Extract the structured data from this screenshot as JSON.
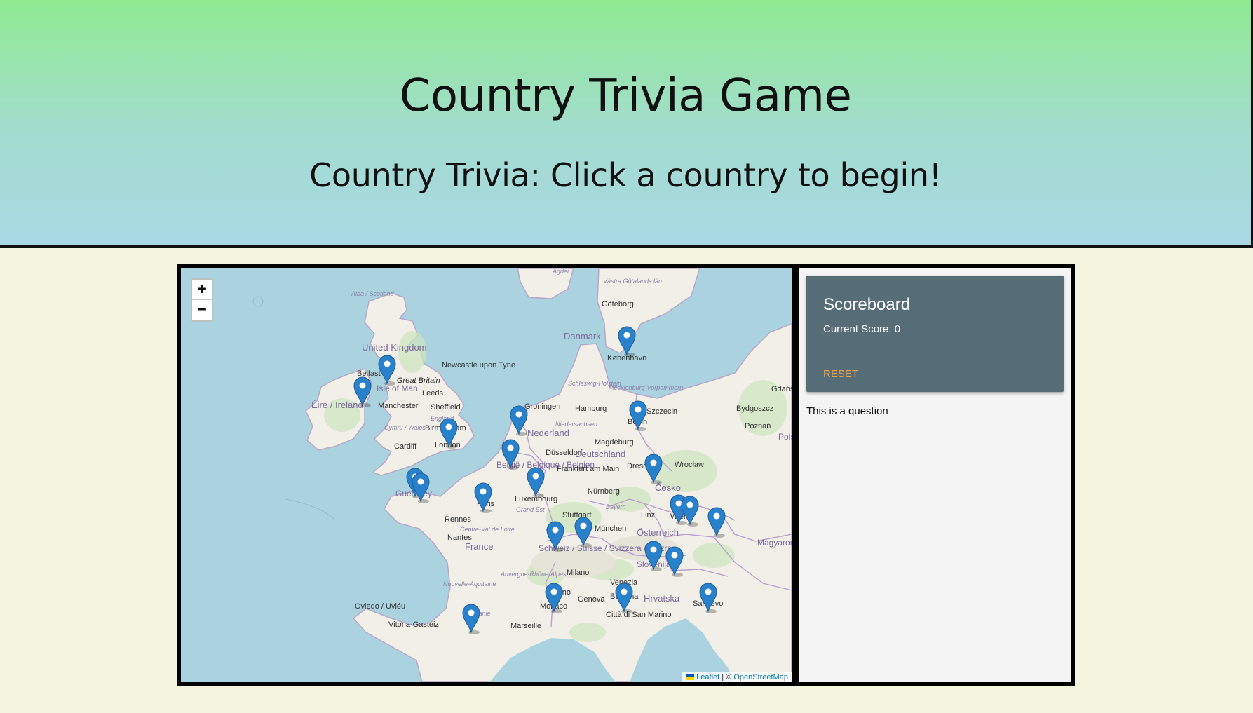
{
  "header": {
    "title": "Country Trivia Game",
    "subtitle": "Country Trivia: Click a country to begin!"
  },
  "map": {
    "zoom_in": "+",
    "zoom_out": "−",
    "attribution_leaflet": "Leaflet",
    "attribution_sep": " | © ",
    "attribution_osm": "OpenStreetMap",
    "colors": {
      "water": "#aad3df",
      "land": "#f2efe9",
      "marker": "#2a81cb"
    },
    "labels": [
      {
        "name": "Agder",
        "style": "region"
      },
      {
        "name": "Västra Götalands län",
        "style": "region"
      },
      {
        "name": "Göteborg",
        "style": "city"
      },
      {
        "name": "Alba / Scotland",
        "style": "region"
      },
      {
        "name": "United Kingdom",
        "style": "country"
      },
      {
        "name": "Danmark",
        "style": "country"
      },
      {
        "name": "København",
        "style": "city"
      },
      {
        "name": "Newcastle upon Tyne",
        "style": "city"
      },
      {
        "name": "Belfast",
        "style": "city"
      },
      {
        "name": "Great Britain",
        "style": "island"
      },
      {
        "name": "Isle of Man",
        "style": "country"
      },
      {
        "name": "Leeds",
        "style": "city"
      },
      {
        "name": "Éire / Ireland",
        "style": "country"
      },
      {
        "name": "Manchester",
        "style": "city"
      },
      {
        "name": "Sheffield",
        "style": "city"
      },
      {
        "name": "England",
        "style": "region"
      },
      {
        "name": "Cymru / Wales",
        "style": "region"
      },
      {
        "name": "Birmingham",
        "style": "city"
      },
      {
        "name": "Cardiff",
        "style": "city"
      },
      {
        "name": "London",
        "style": "city"
      },
      {
        "name": "Schleswig-Holstein",
        "style": "region"
      },
      {
        "name": "Mecklenburg-Vorpommern",
        "style": "region"
      },
      {
        "name": "Groningen",
        "style": "city"
      },
      {
        "name": "Hamburg",
        "style": "city"
      },
      {
        "name": "Szczecin",
        "style": "city"
      },
      {
        "name": "Gdańsk",
        "style": "city"
      },
      {
        "name": "Bydgoszcz",
        "style": "city"
      },
      {
        "name": "Niedersachsen",
        "style": "region"
      },
      {
        "name": "Nederland",
        "style": "country"
      },
      {
        "name": "Berlin",
        "style": "city"
      },
      {
        "name": "Poznań",
        "style": "city"
      },
      {
        "name": "Magdeburg",
        "style": "city"
      },
      {
        "name": "Polska",
        "style": "country"
      },
      {
        "name": "Düsseldorf",
        "style": "city"
      },
      {
        "name": "Deutschland",
        "style": "country"
      },
      {
        "name": "België / Belgique / Belgien",
        "style": "country"
      },
      {
        "name": "Frankfurt am Main",
        "style": "city"
      },
      {
        "name": "Dresden",
        "style": "city"
      },
      {
        "name": "Wrocław",
        "style": "city"
      },
      {
        "name": "Guernsey",
        "style": "country"
      },
      {
        "name": "Luxembourg",
        "style": "country"
      },
      {
        "name": "Česko",
        "style": "country"
      },
      {
        "name": "Paris",
        "style": "city"
      },
      {
        "name": "Nürnberg",
        "style": "city"
      },
      {
        "name": "Grand Est",
        "style": "region"
      },
      {
        "name": "Bayern",
        "style": "region"
      },
      {
        "name": "Stuttgart",
        "style": "city"
      },
      {
        "name": "Linz",
        "style": "city"
      },
      {
        "name": "Wien",
        "style": "city"
      },
      {
        "name": "Rennes",
        "style": "city"
      },
      {
        "name": "München",
        "style": "city"
      },
      {
        "name": "Centre-Val de Loire",
        "style": "region"
      },
      {
        "name": "Österreich",
        "style": "country"
      },
      {
        "name": "Nantes",
        "style": "city"
      },
      {
        "name": "Schweiz / Suisse / Svizzera / Svizra",
        "style": "country"
      },
      {
        "name": "Magyarország",
        "style": "country"
      },
      {
        "name": "France",
        "style": "country"
      },
      {
        "name": "Slovenija",
        "style": "country"
      },
      {
        "name": "Auvergne-Rhône-Alpes",
        "style": "region"
      },
      {
        "name": "Milano",
        "style": "city"
      },
      {
        "name": "Nouvelle-Aquitaine",
        "style": "region"
      },
      {
        "name": "Venezia",
        "style": "city"
      },
      {
        "name": "Torino",
        "style": "city"
      },
      {
        "name": "Hrvatska",
        "style": "country"
      },
      {
        "name": "Genova",
        "style": "city"
      },
      {
        "name": "Bologna",
        "style": "city"
      },
      {
        "name": "Monaco",
        "style": "country"
      },
      {
        "name": "Sarajevo",
        "style": "city"
      },
      {
        "name": "Oviedo / Uviéu",
        "style": "city"
      },
      {
        "name": "Occitanie",
        "style": "region"
      },
      {
        "name": "Città di San Marino",
        "style": "city"
      },
      {
        "name": "Vitoria-Gasteiz",
        "style": "city"
      },
      {
        "name": "Marseille",
        "style": "city"
      }
    ],
    "marker_count": 22
  },
  "scoreboard": {
    "title": "Scoreboard",
    "score_label": "Current Score: 0",
    "reset_label": "RESET"
  },
  "question": {
    "text": "This is a question"
  }
}
